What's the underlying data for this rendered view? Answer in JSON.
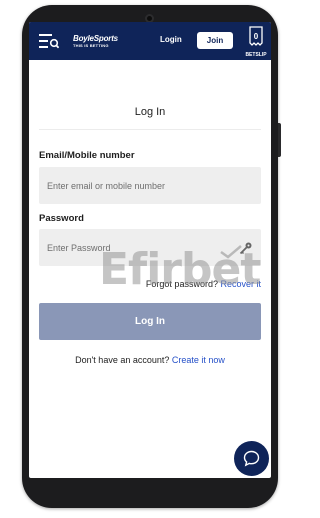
{
  "header": {
    "brand_name": "BoyleSports",
    "tagline": "THIS IS BETTING",
    "login_label": "Login",
    "join_label": "Join",
    "betslip_label": "BETSLIP",
    "betslip_count": "0",
    "icons": [
      "menu-search-icon",
      "betslip-icon"
    ],
    "bg_color": "#0f2459"
  },
  "form": {
    "title": "Log In",
    "email_label": "Email/Mobile number",
    "email_placeholder": "Enter email or mobile number",
    "password_label": "Password",
    "password_placeholder": "Enter Password",
    "forgot_text": "Forgot password?",
    "recover_link": "Recover it",
    "submit_label": "Log In",
    "signup_text": "Don't have an account?",
    "signup_link": "Create it now"
  },
  "watermark": "Efirbet",
  "colors": {
    "primary": "#0f2459",
    "button_disabled": "#8a97b7",
    "link": "#2550c8"
  }
}
